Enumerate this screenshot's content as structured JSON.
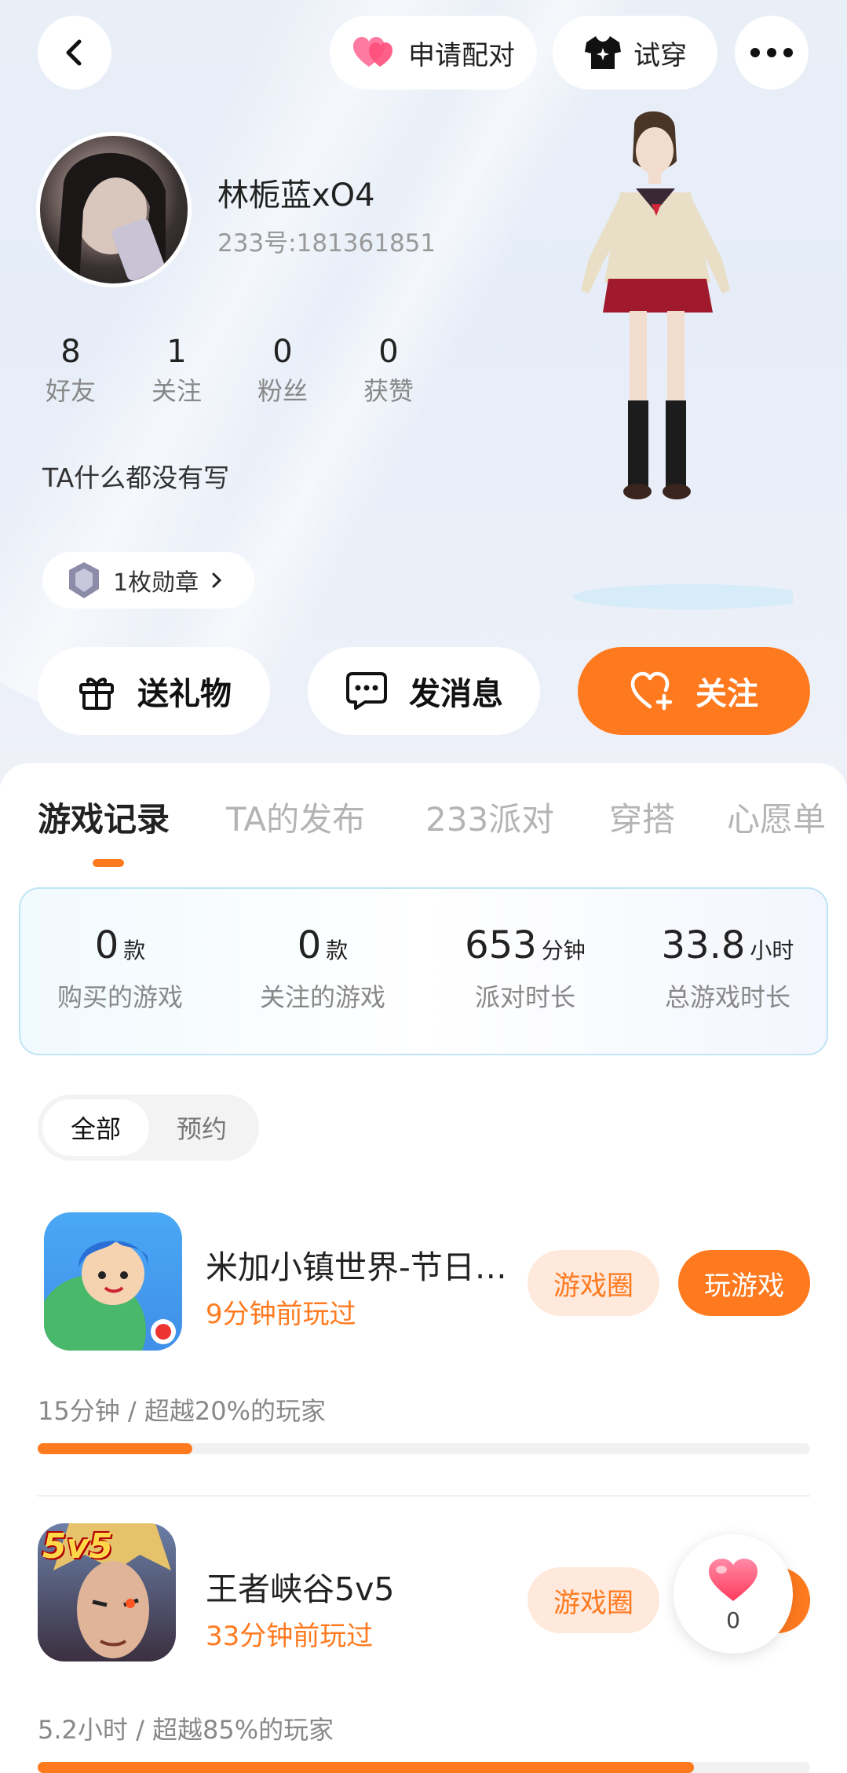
{
  "header": {
    "back_icon": "chevron-left-icon",
    "pair_label": "申请配对",
    "tryon_label": "试穿",
    "more_icon": "more-dots-icon"
  },
  "profile": {
    "name": "林栀蓝xO4",
    "id_text": "233号:181361851",
    "stats": [
      {
        "num": "8",
        "label": "好友"
      },
      {
        "num": "1",
        "label": "关注"
      },
      {
        "num": "0",
        "label": "粉丝"
      },
      {
        "num": "0",
        "label": "获赞"
      }
    ],
    "bio": "TA什么都没有写",
    "medal_label": "1枚勋章"
  },
  "actions": {
    "gift_label": "送礼物",
    "message_label": "发消息",
    "follow_label": "关注"
  },
  "tabs": [
    "游戏记录",
    "TA的发布",
    "233派对",
    "穿搭",
    "心愿单"
  ],
  "summary": [
    {
      "value": "0",
      "unit": "款",
      "label": "购买的游戏"
    },
    {
      "value": "0",
      "unit": "款",
      "label": "关注的游戏"
    },
    {
      "value": "653",
      "unit": "分钟",
      "label": "派对时长"
    },
    {
      "value": "33.8",
      "unit": "小时",
      "label": "总游戏时长"
    }
  ],
  "filter": {
    "all": "全部",
    "reserve": "预约"
  },
  "games": [
    {
      "name": "米加小镇世界-节日…",
      "played": "9分钟前玩过",
      "circle_label": "游戏圈",
      "play_label": "玩游戏",
      "stat": "15分钟 / 超越20%的玩家",
      "progress": 0.2
    },
    {
      "name": "王者峡谷5v5",
      "played": "33分钟前玩过",
      "circle_label": "游戏圈",
      "icon_text": "5v5",
      "stat": "5.2小时 / 超越85%的玩家",
      "progress": 0.85
    }
  ],
  "floating_like": {
    "count": "0"
  },
  "colors": {
    "accent": "#ff7a1f",
    "accent_light": "#ffe9dc",
    "heart": "#ff4f7b"
  }
}
